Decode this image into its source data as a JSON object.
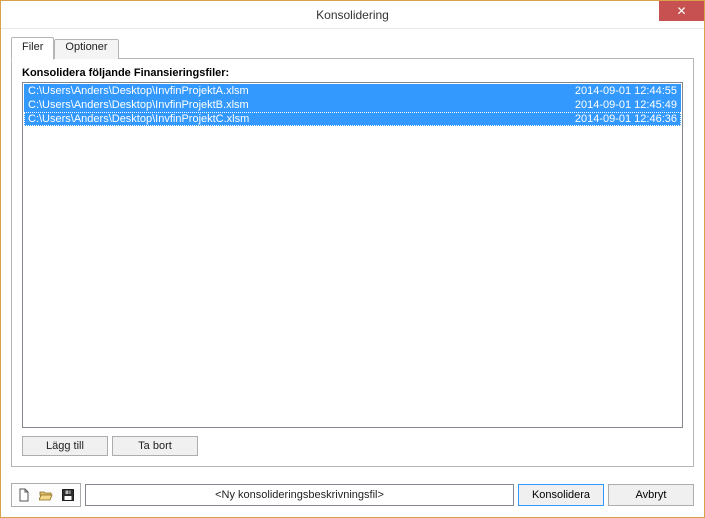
{
  "window": {
    "title": "Konsolidering",
    "close_glyph": "✕"
  },
  "tabs": {
    "files": "Filer",
    "options": "Optioner"
  },
  "panel": {
    "list_label": "Konsolidera följande Finansieringsfiler:",
    "files": [
      {
        "path": "C:\\Users\\Anders\\Desktop\\InvfinProjektA.xlsm",
        "ts": "2014-09-01 12:44:55"
      },
      {
        "path": "C:\\Users\\Anders\\Desktop\\InvfinProjektB.xlsm",
        "ts": "2014-09-01 12:45:49"
      },
      {
        "path": "C:\\Users\\Anders\\Desktop\\InvfinProjektC.xlsm",
        "ts": "2014-09-01 12:46:36"
      }
    ],
    "add_label": "Lägg till",
    "remove_label": "Ta bort"
  },
  "bottombar": {
    "desc_placeholder": "<Ny konsolideringsbeskrivningsfil>",
    "consolidate_label": "Konsolidera",
    "cancel_label": "Avbryt"
  }
}
